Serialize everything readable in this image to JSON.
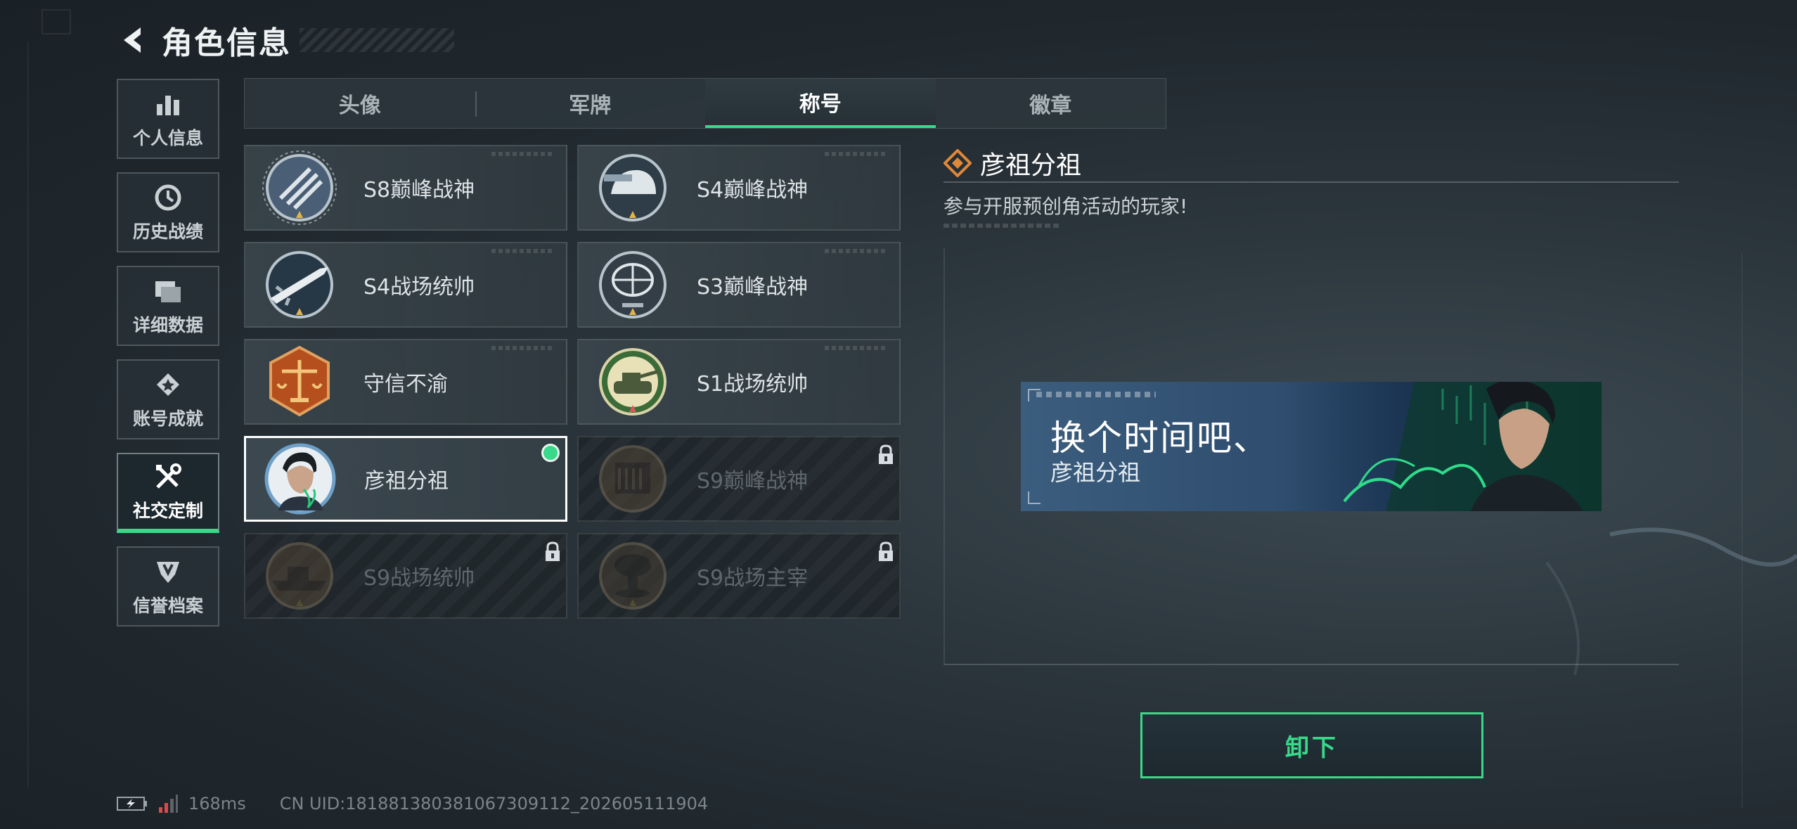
{
  "header": {
    "title": "角色信息"
  },
  "sidebar": {
    "items": [
      {
        "label": "个人信息",
        "icon": "bar-chart-icon"
      },
      {
        "label": "历史战绩",
        "icon": "clock-icon"
      },
      {
        "label": "详细数据",
        "icon": "folder-icon"
      },
      {
        "label": "账号成就",
        "icon": "achievement-icon"
      },
      {
        "label": "社交定制",
        "icon": "tools-icon",
        "active": true
      },
      {
        "label": "信誉档案",
        "icon": "shield-icon"
      }
    ]
  },
  "tabs": [
    {
      "label": "头像"
    },
    {
      "label": "军牌"
    },
    {
      "label": "称号",
      "active": true
    },
    {
      "label": "徽章"
    }
  ],
  "titles": [
    {
      "name": "S8巅峰战神",
      "icon": "wings-emblem-icon",
      "locked": false
    },
    {
      "name": "S4巅峰战神",
      "icon": "helmet-emblem-icon",
      "locked": false
    },
    {
      "name": "S4战场统帅",
      "icon": "missile-emblem-icon",
      "locked": false
    },
    {
      "name": "S3巅峰战神",
      "icon": "globe-emblem-icon",
      "locked": false
    },
    {
      "name": "守信不渝",
      "icon": "scales-emblem-icon",
      "locked": false
    },
    {
      "name": "S1战场统帅",
      "icon": "tank-emblem-icon",
      "locked": false
    },
    {
      "name": "彦祖分祖",
      "icon": "portrait-emblem-icon",
      "locked": false,
      "selected": true
    },
    {
      "name": "S9巅峰战神",
      "icon": "building-emblem-icon",
      "locked": true
    },
    {
      "name": "S9战场统帅",
      "icon": "warship-emblem-icon",
      "locked": true
    },
    {
      "name": "S9战场主宰",
      "icon": "mushroom-cloud-emblem-icon",
      "locked": true
    }
  ],
  "detail": {
    "title": "彦祖分祖",
    "description": "参与开服预创角活动的玩家!",
    "banner_main": "换个时间吧、",
    "banner_sub": "彦祖分祖",
    "unequip_label": "卸下"
  },
  "status": {
    "ping": "168ms",
    "uid": "CN UID:181881380381067309112_202605111904"
  },
  "colors": {
    "accent": "#39d98a",
    "background": "#263037"
  }
}
